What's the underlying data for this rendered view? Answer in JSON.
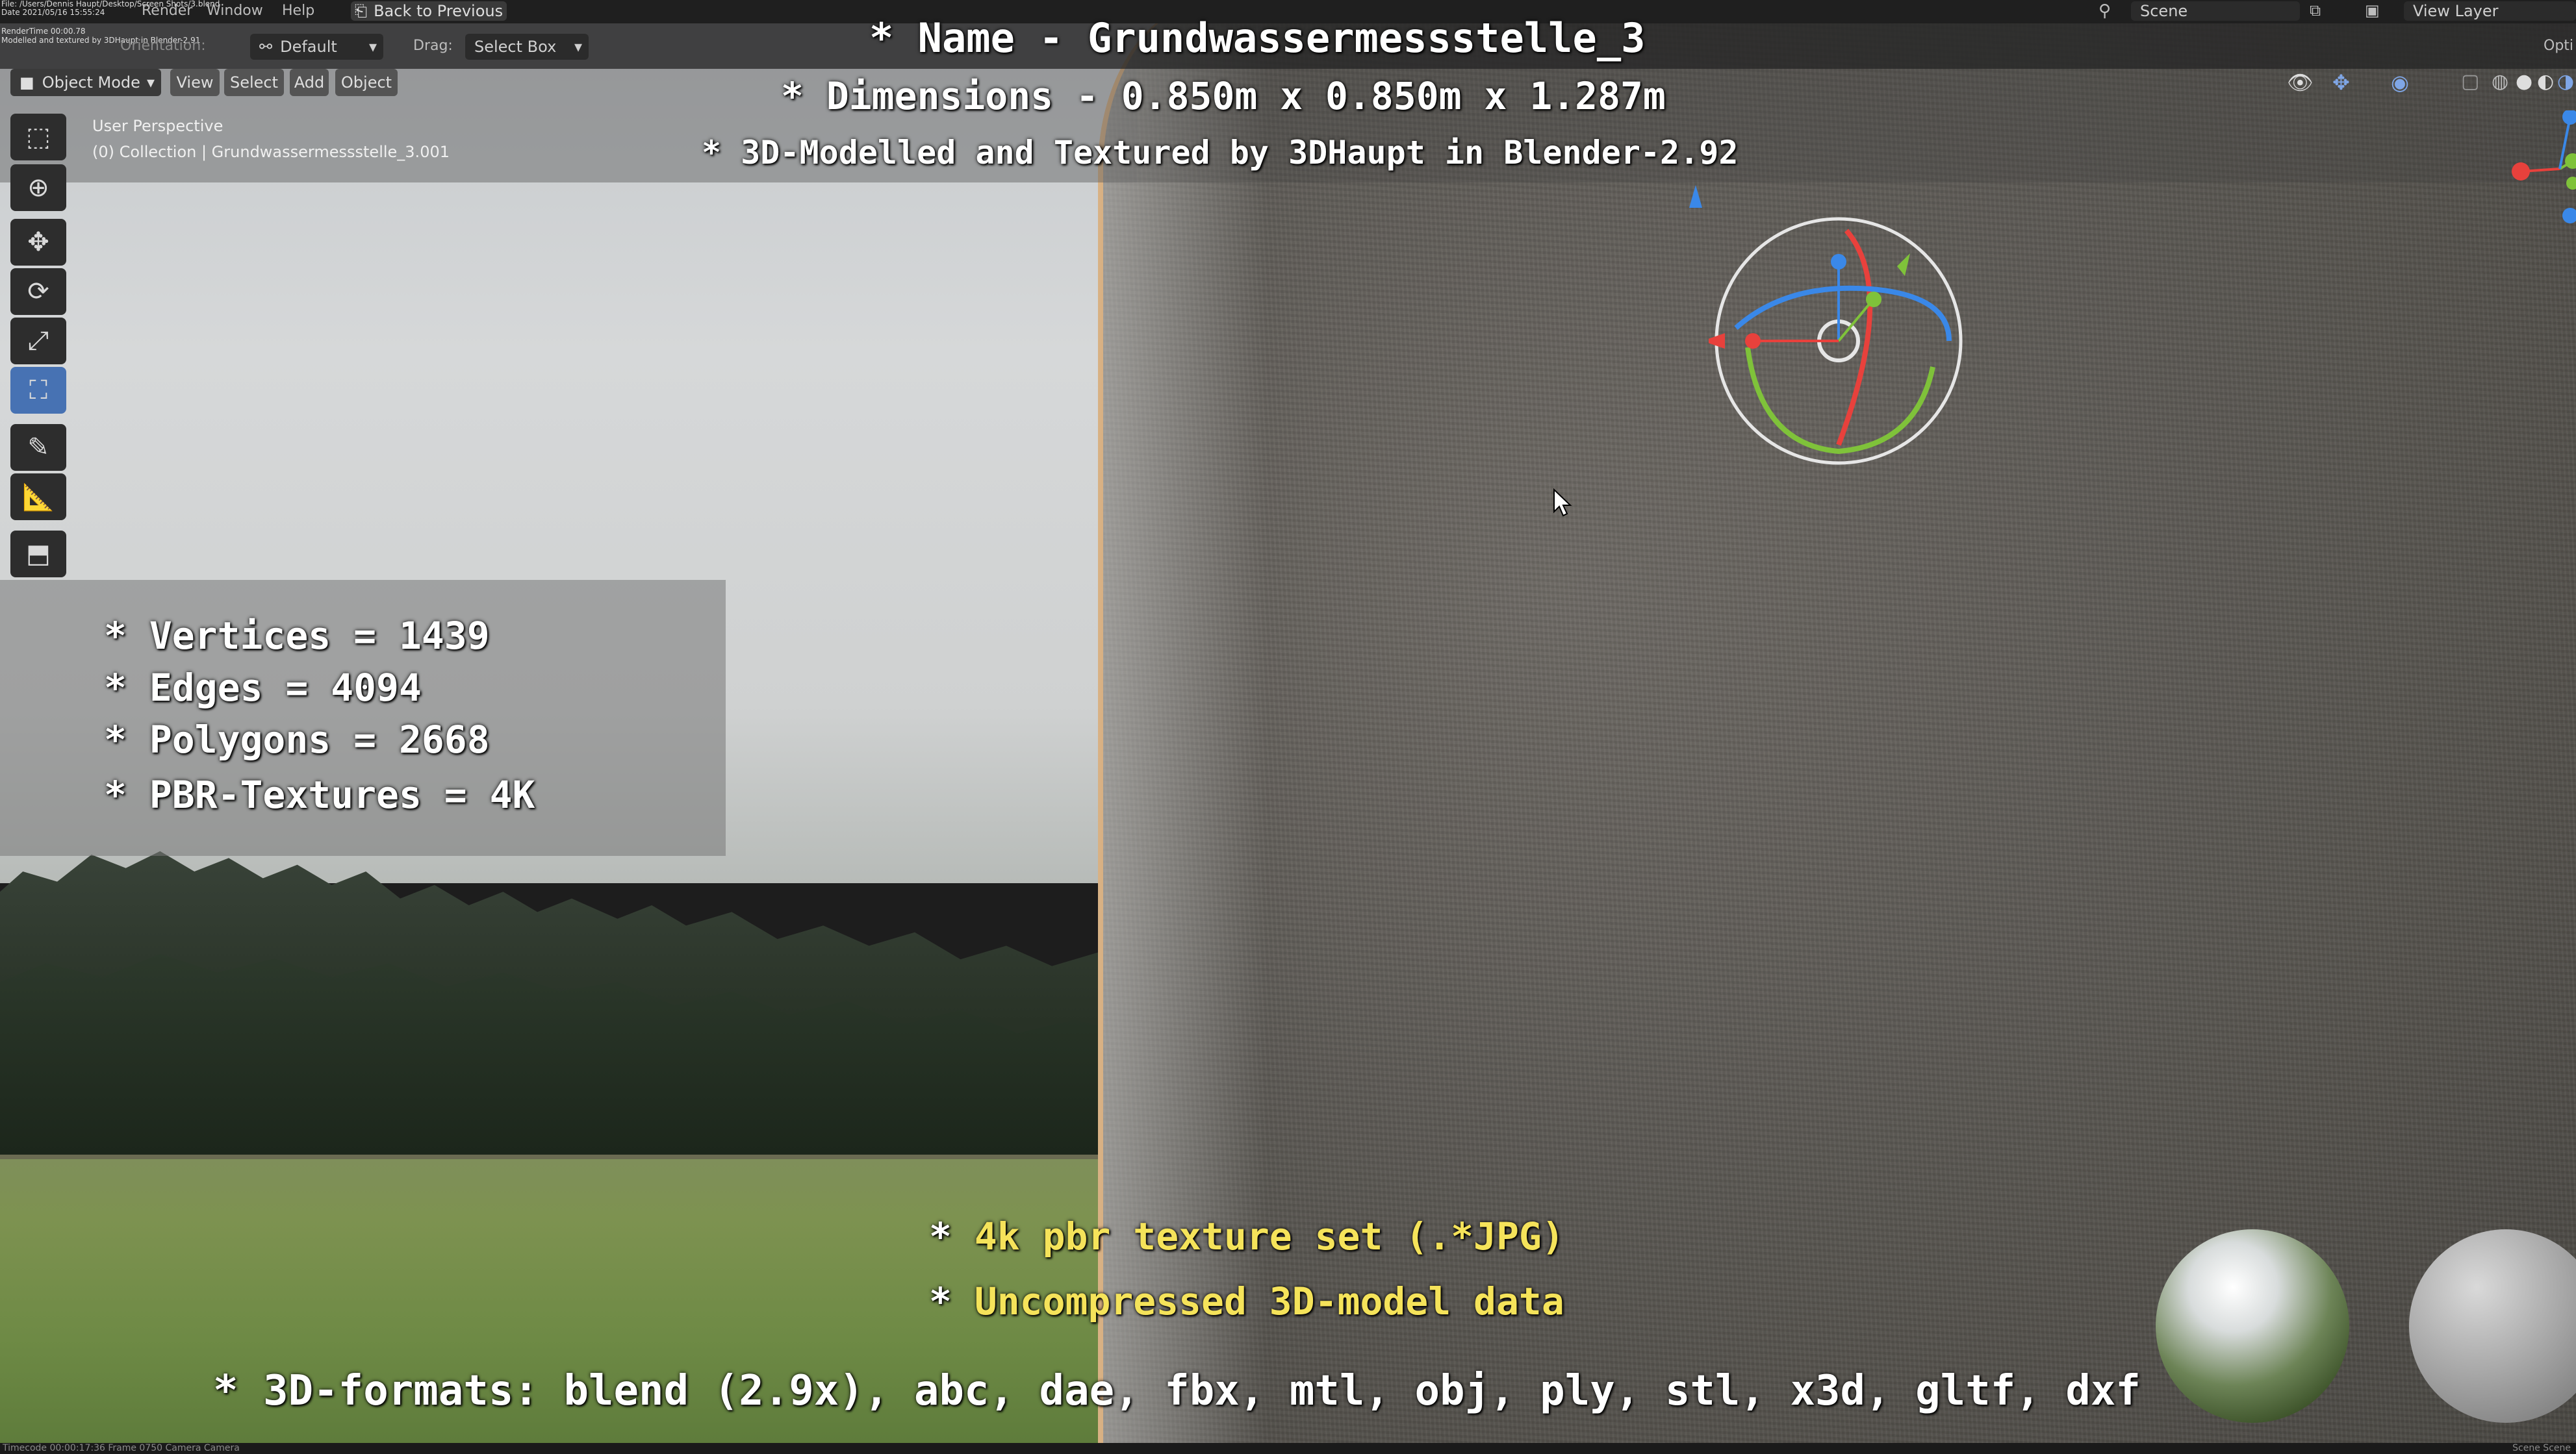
{
  "app": {
    "title_line": "File: /Users/Dennis Haupt/Desktop/Screen Shots/3.blend",
    "date_line": "Date 2021/05/16 15:55:24",
    "rendertime_line": "RenderTime 00:00.78",
    "credit_line": "Modelled and textured by 3DHaupt in Blender-2.91"
  },
  "menu": {
    "items": [
      "Render",
      "Window",
      "Help"
    ],
    "back_button": "Back to Previous",
    "scene_label": "Scene",
    "view_layer_label": "View Layer"
  },
  "toolbar": {
    "orientation_label": "Orientation:",
    "pivot_label": "Default",
    "drag_label": "Drag:",
    "drag_value": "Select Box",
    "options_label": "Opti"
  },
  "viewport_header": {
    "mode": "Object Mode",
    "menus": [
      "View",
      "Select",
      "Add",
      "Object"
    ]
  },
  "viewport_info": {
    "perspective": "User Perspective",
    "collection": "(0) Collection | Grundwassermessstelle_3.001"
  },
  "overlay": {
    "name_line": "* Name - Grundwassermessstelle_3",
    "dimensions_line": "* Dimensions -  0.850m x 0.850m x 1.287m",
    "credit_line": "* 3D-Modelled and Textured by 3DHaupt in Blender-2.92",
    "stats": [
      "* Vertices = 1439",
      "* Edges = 4094",
      "* Polygons = 2668",
      "* PBR-Textures = 4K"
    ],
    "bottom_line1_star": "*",
    "bottom_line1_text": "4k pbr texture set (.*JPG)",
    "bottom_line2_star": "*",
    "bottom_line2_text": "Uncompressed 3D-model data",
    "formats_line": "* 3D-formats: blend (2.9x), abc, dae, fbx, mtl, obj, ply, stl, x3d, gltf, dxf"
  },
  "status_bar": {
    "left": "Timecode 00:00:17:36   Frame 0750   Camera Camera",
    "right": "Scene Scene"
  },
  "colors": {
    "selection_outline": "#e08a2a",
    "active_tool": "#4772b3",
    "axis_x": "#e8413c",
    "axis_y": "#7fc23a",
    "axis_z": "#3a88e8",
    "highlight_text": "#f5e35a"
  },
  "icons": {
    "left_toolbar": [
      "select-box-icon",
      "cursor-icon",
      "move-icon",
      "rotate-icon",
      "scale-icon",
      "transform-icon",
      "annotate-icon",
      "measure-icon",
      "add-cube-icon"
    ]
  }
}
